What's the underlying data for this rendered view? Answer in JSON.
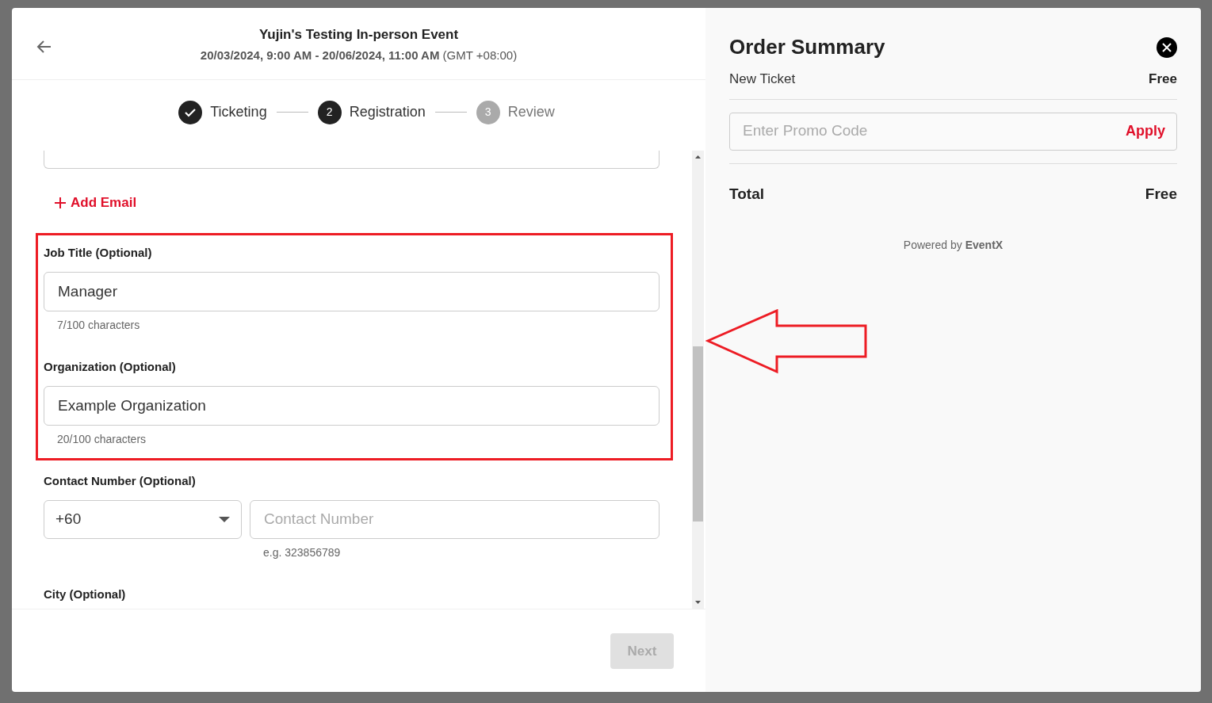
{
  "event": {
    "title": "Yujin's Testing In-person Event",
    "dates": "**20/03/2024, 9:00 AM - 20/06/2024, 11:00 AM** (GMT +08:00)"
  },
  "steps": [
    {
      "kind": "done",
      "label": "Ticketing"
    },
    {
      "kind": "current",
      "label": "Registration",
      "number": "2"
    },
    {
      "kind": "upcoming",
      "label": "Review",
      "number": "3"
    }
  ],
  "form": {
    "add_email": "Add Email",
    "fields": [
      {
        "kind": "text",
        "label": "Job Title (Optional)",
        "value": "Manager",
        "counter": "7/100 characters"
      },
      {
        "kind": "text",
        "label": "Organization (Optional)",
        "value": "Example Organization",
        "counter": "20/100 characters"
      },
      {
        "kind": "phone",
        "label": "Contact Number (Optional)",
        "country_code": "+60",
        "placeholder": "Contact Number",
        "hint": "e.g. 323856789"
      },
      {
        "kind": "label",
        "label": "City (Optional)"
      }
    ]
  },
  "next_button": {
    "label": "Next",
    "disabled": true
  },
  "order_summary": {
    "title": "Order Summary",
    "item": {
      "name": "New Ticket",
      "price": "Free"
    },
    "promo": {
      "placeholder": "Enter Promo Code",
      "apply": "Apply"
    },
    "total": {
      "label": "Total",
      "value": "Free"
    },
    "powered_by": "Powered by **EventX**"
  }
}
